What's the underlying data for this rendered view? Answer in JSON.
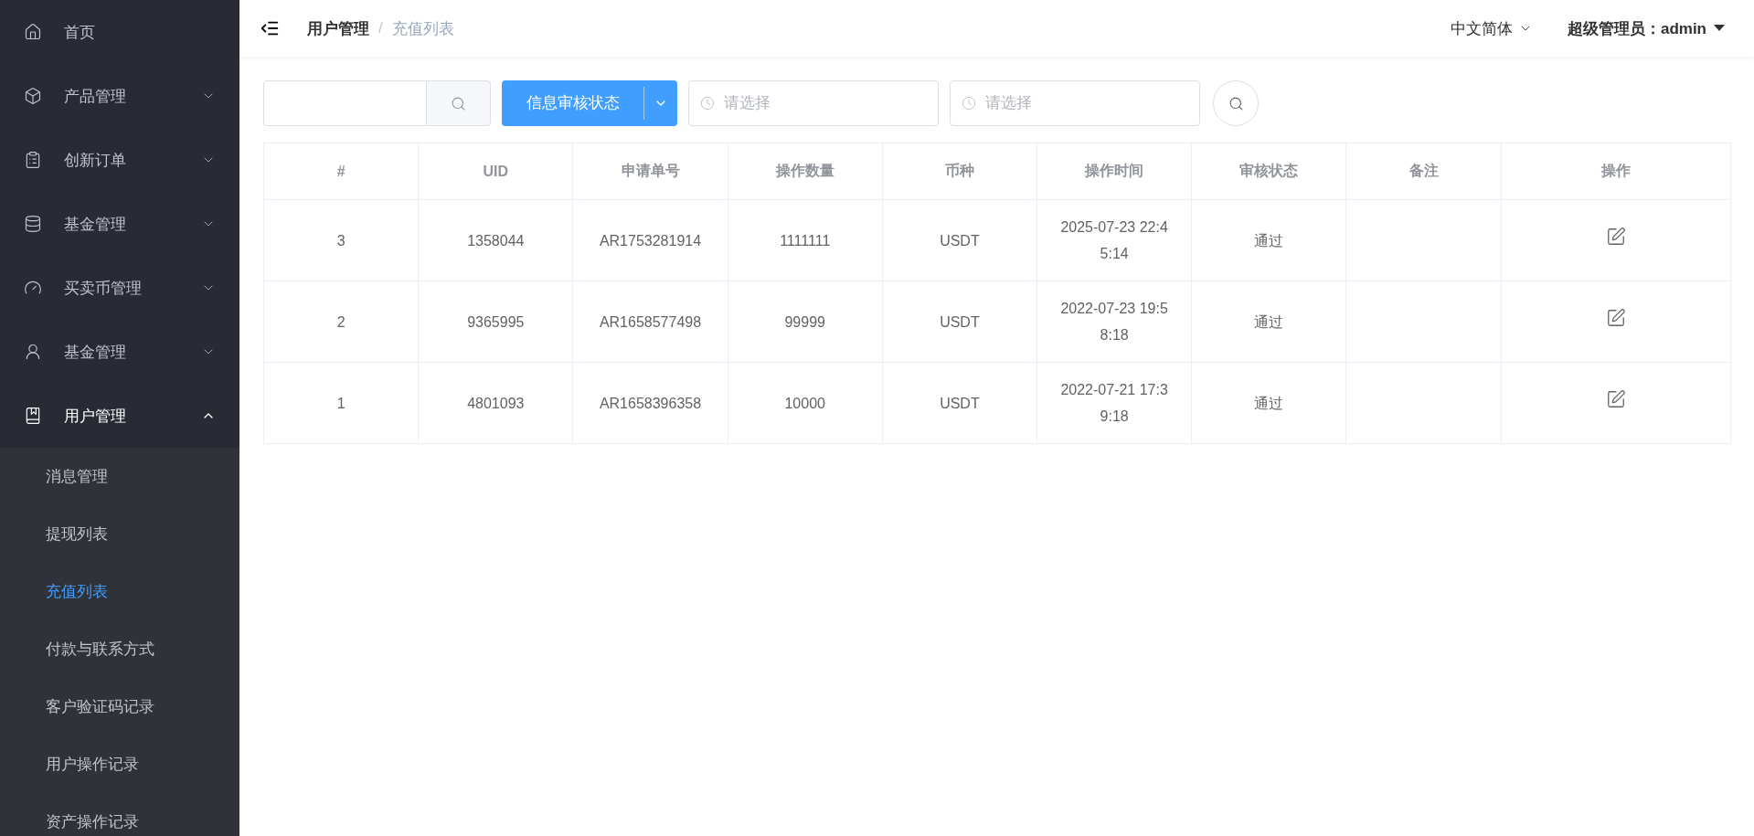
{
  "sidebar": {
    "items": [
      {
        "label": "首页",
        "kind": "link",
        "expanded": false
      },
      {
        "label": "产品管理",
        "kind": "submenu",
        "expanded": false
      },
      {
        "label": "创新订单",
        "kind": "submenu",
        "expanded": false
      },
      {
        "label": "基金管理",
        "kind": "submenu",
        "expanded": false
      },
      {
        "label": "买卖币管理",
        "kind": "submenu",
        "expanded": false
      },
      {
        "label": "基金管理",
        "kind": "submenu",
        "expanded": false
      },
      {
        "label": "用户管理",
        "kind": "submenu",
        "expanded": true,
        "children": [
          {
            "label": "消息管理",
            "selected": false
          },
          {
            "label": "提现列表",
            "selected": false
          },
          {
            "label": "充值列表",
            "selected": true
          },
          {
            "label": "付款与联系方式",
            "selected": false
          },
          {
            "label": "客户验证码记录",
            "selected": false
          },
          {
            "label": "用户操作记录",
            "selected": false
          },
          {
            "label": "资产操作记录",
            "selected": false
          }
        ]
      }
    ]
  },
  "header": {
    "breadcrumb": [
      "用户管理",
      "充值列表"
    ],
    "breadcrumb_separator": "/",
    "language": "中文简体",
    "user": "超级管理员：admin"
  },
  "filters": {
    "status_button": "信息审核状态",
    "start_date": {
      "placeholder": "请选择"
    },
    "end_date": {
      "placeholder": "请选择"
    }
  },
  "table": {
    "columns": [
      "#",
      "UID",
      "申请单号",
      "操作数量",
      "币种",
      "操作时间",
      "审核状态",
      "备注",
      "操作"
    ],
    "rows": [
      [
        "3",
        "1358044",
        "AR1753281914",
        "1111111",
        "USDT",
        "2025-07-23 22:45:14",
        "通过",
        ""
      ],
      [
        "2",
        "9365995",
        "AR1658577498",
        "99999",
        "USDT",
        "2022-07-23 19:58:18",
        "通过",
        ""
      ],
      [
        "1",
        "4801093",
        "AR1658396358",
        "10000",
        "USDT",
        "2022-07-21 17:39:18",
        "通过",
        ""
      ]
    ]
  }
}
